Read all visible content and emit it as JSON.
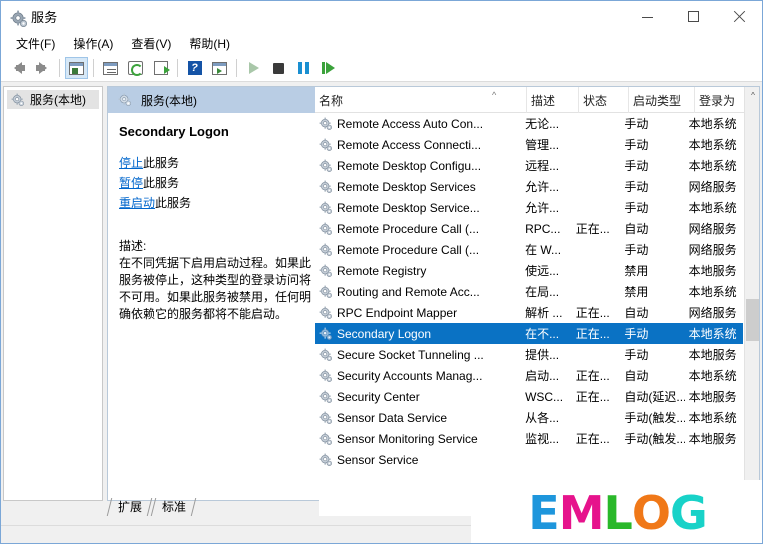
{
  "window": {
    "title": "服务",
    "icon": "services-gear-icon",
    "minimize_label": "最小化",
    "maximize_label": "最大化",
    "close_label": "关闭"
  },
  "menubar": {
    "items": [
      {
        "label": "文件(F)",
        "name": "menu-file"
      },
      {
        "label": "操作(A)",
        "name": "menu-action"
      },
      {
        "label": "查看(V)",
        "name": "menu-view"
      },
      {
        "label": "帮助(H)",
        "name": "menu-help"
      }
    ]
  },
  "toolbar": {
    "items": [
      {
        "name": "back-arrow-icon",
        "label": "后退"
      },
      {
        "name": "forward-arrow-icon",
        "label": "前进"
      },
      {
        "name": "show-tree-icon",
        "label": "显示/隐藏控制台树"
      },
      {
        "name": "properties-icon",
        "label": "属性"
      },
      {
        "name": "refresh-icon",
        "label": "刷新"
      },
      {
        "name": "export-list-icon",
        "label": "导出列表"
      },
      {
        "name": "help-icon",
        "label": "帮助"
      },
      {
        "name": "console-view-icon",
        "label": "显示/隐藏操作窗格"
      },
      {
        "name": "start-service-icon",
        "label": "启动服务"
      },
      {
        "name": "stop-service-icon",
        "label": "停止服务"
      },
      {
        "name": "pause-service-icon",
        "label": "暂停服务"
      },
      {
        "name": "restart-service-icon",
        "label": "重启服务"
      }
    ]
  },
  "tree": {
    "root_label": "服务(本地)",
    "root_icon": "services-gear-icon"
  },
  "details": {
    "header_label": "服务(本地)",
    "header_icon": "services-gear-icon",
    "service_name": "Secondary Logon",
    "actions": [
      {
        "link": "停止",
        "rest": "此服务",
        "name": "stop-service-link"
      },
      {
        "link": "暂停",
        "rest": "此服务",
        "name": "pause-service-link"
      },
      {
        "link": "重启动",
        "rest": "此服务",
        "name": "restart-service-link"
      }
    ],
    "description_label": "描述:",
    "description_text": "在不同凭据下启用启动过程。如果此服务被停止，这种类型的登录访问将不可用。如果此服务被禁用，任何明确依赖它的服务都将不能启动。"
  },
  "list": {
    "columns": [
      {
        "label": "名称",
        "name": "column-name",
        "sorted": "asc"
      },
      {
        "label": "描述",
        "name": "column-description"
      },
      {
        "label": "状态",
        "name": "column-status"
      },
      {
        "label": "启动类型",
        "name": "column-startup-type"
      },
      {
        "label": "登录为",
        "name": "column-log-on-as"
      }
    ],
    "rows": [
      {
        "name": "Remote Access Auto Con...",
        "description": "无论...",
        "status": "",
        "startup": "手动",
        "logon": "本地系统",
        "selected": false
      },
      {
        "name": "Remote Access Connecti...",
        "description": "管理...",
        "status": "",
        "startup": "手动",
        "logon": "本地系统",
        "selected": false
      },
      {
        "name": "Remote Desktop Configu...",
        "description": "远程...",
        "status": "",
        "startup": "手动",
        "logon": "本地系统",
        "selected": false
      },
      {
        "name": "Remote Desktop Services",
        "description": "允许...",
        "status": "",
        "startup": "手动",
        "logon": "网络服务",
        "selected": false
      },
      {
        "name": "Remote Desktop Service...",
        "description": "允许...",
        "status": "",
        "startup": "手动",
        "logon": "本地系统",
        "selected": false
      },
      {
        "name": "Remote Procedure Call (...",
        "description": "RPC...",
        "status": "正在...",
        "startup": "自动",
        "logon": "网络服务",
        "selected": false
      },
      {
        "name": "Remote Procedure Call (...",
        "description": "在 W...",
        "status": "",
        "startup": "手动",
        "logon": "网络服务",
        "selected": false
      },
      {
        "name": "Remote Registry",
        "description": "使远...",
        "status": "",
        "startup": "禁用",
        "logon": "本地服务",
        "selected": false
      },
      {
        "name": "Routing and Remote Acc...",
        "description": "在局...",
        "status": "",
        "startup": "禁用",
        "logon": "本地系统",
        "selected": false
      },
      {
        "name": "RPC Endpoint Mapper",
        "description": "解析 ...",
        "status": "正在...",
        "startup": "自动",
        "logon": "网络服务",
        "selected": false
      },
      {
        "name": "Secondary Logon",
        "description": "在不...",
        "status": "正在...",
        "startup": "手动",
        "logon": "本地系统",
        "selected": true
      },
      {
        "name": "Secure Socket Tunneling ...",
        "description": "提供...",
        "status": "",
        "startup": "手动",
        "logon": "本地服务",
        "selected": false
      },
      {
        "name": "Security Accounts Manag...",
        "description": "启动...",
        "status": "正在...",
        "startup": "自动",
        "logon": "本地系统",
        "selected": false
      },
      {
        "name": "Security Center",
        "description": "WSC...",
        "status": "正在...",
        "startup": "自动(延迟...",
        "logon": "本地服务",
        "selected": false
      },
      {
        "name": "Sensor Data Service",
        "description": "从各...",
        "status": "",
        "startup": "手动(触发...",
        "logon": "本地系统",
        "selected": false
      },
      {
        "name": "Sensor Monitoring Service",
        "description": "监视...",
        "status": "正在...",
        "startup": "手动(触发...",
        "logon": "本地服务",
        "selected": false
      },
      {
        "name": "Sensor Service",
        "description": "",
        "status": "",
        "startup": "",
        "logon": "",
        "selected": false
      }
    ]
  },
  "tabs": [
    {
      "label": "扩展",
      "name": "tab-extended",
      "active": false
    },
    {
      "label": "标准",
      "name": "tab-standard",
      "active": true
    }
  ],
  "watermark": {
    "letters": [
      {
        "char": "E",
        "color": "#1e96dc"
      },
      {
        "char": "M",
        "color": "#e6138c"
      },
      {
        "char": "L",
        "color": "#2ab82a"
      },
      {
        "char": "O",
        "color": "#f07818"
      },
      {
        "char": "G",
        "color": "#18d2c8"
      }
    ]
  },
  "colors": {
    "selection_blue": "#0a72c4",
    "details_header": "#b9cde4",
    "window_border": "#7ba7d7"
  }
}
